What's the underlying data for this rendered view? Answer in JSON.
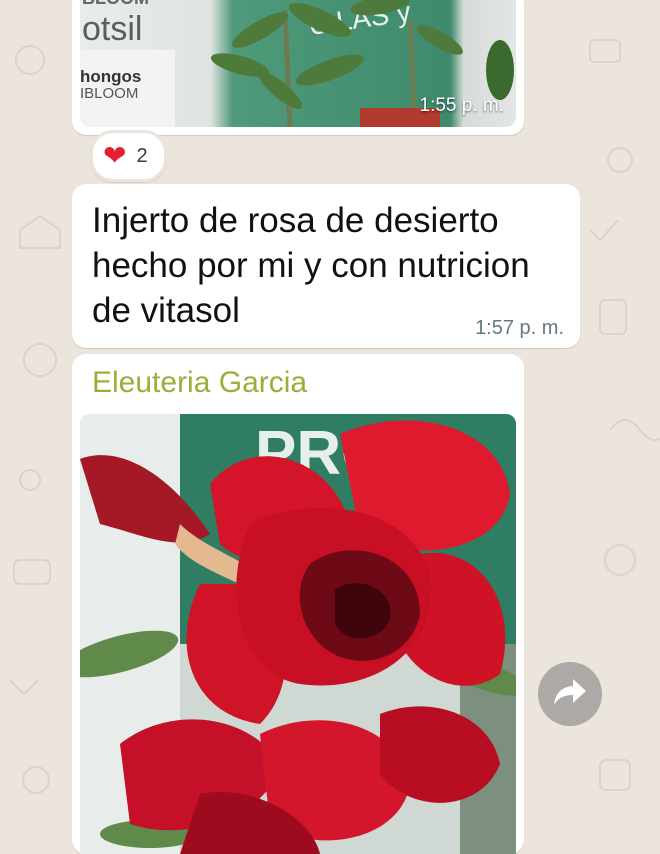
{
  "messages": [
    {
      "type": "image",
      "time": "1:55 p. m.",
      "photo_text": {
        "brand_top": "BLOOM",
        "brand_mid": "otsil",
        "brand_low1": "hongos",
        "brand_low2": "IBLOOM",
        "banner": "U  LAS y"
      },
      "reaction": {
        "emoji": "❤",
        "count": "2"
      }
    },
    {
      "type": "text",
      "text": "Injerto de rosa de desierto hecho por mi y con nutricion de vitasol",
      "time": "1:57 p. m."
    },
    {
      "type": "image",
      "sender": "Eleuteria Garcia",
      "photo_text": {
        "banner": "PRO"
      }
    }
  ],
  "icons": {
    "forward": "forward-icon",
    "reaction": "heart-icon"
  },
  "colors": {
    "sender_name": "#9cae3a",
    "chat_bg": "#ece5dd",
    "heart": "#e5202e"
  }
}
